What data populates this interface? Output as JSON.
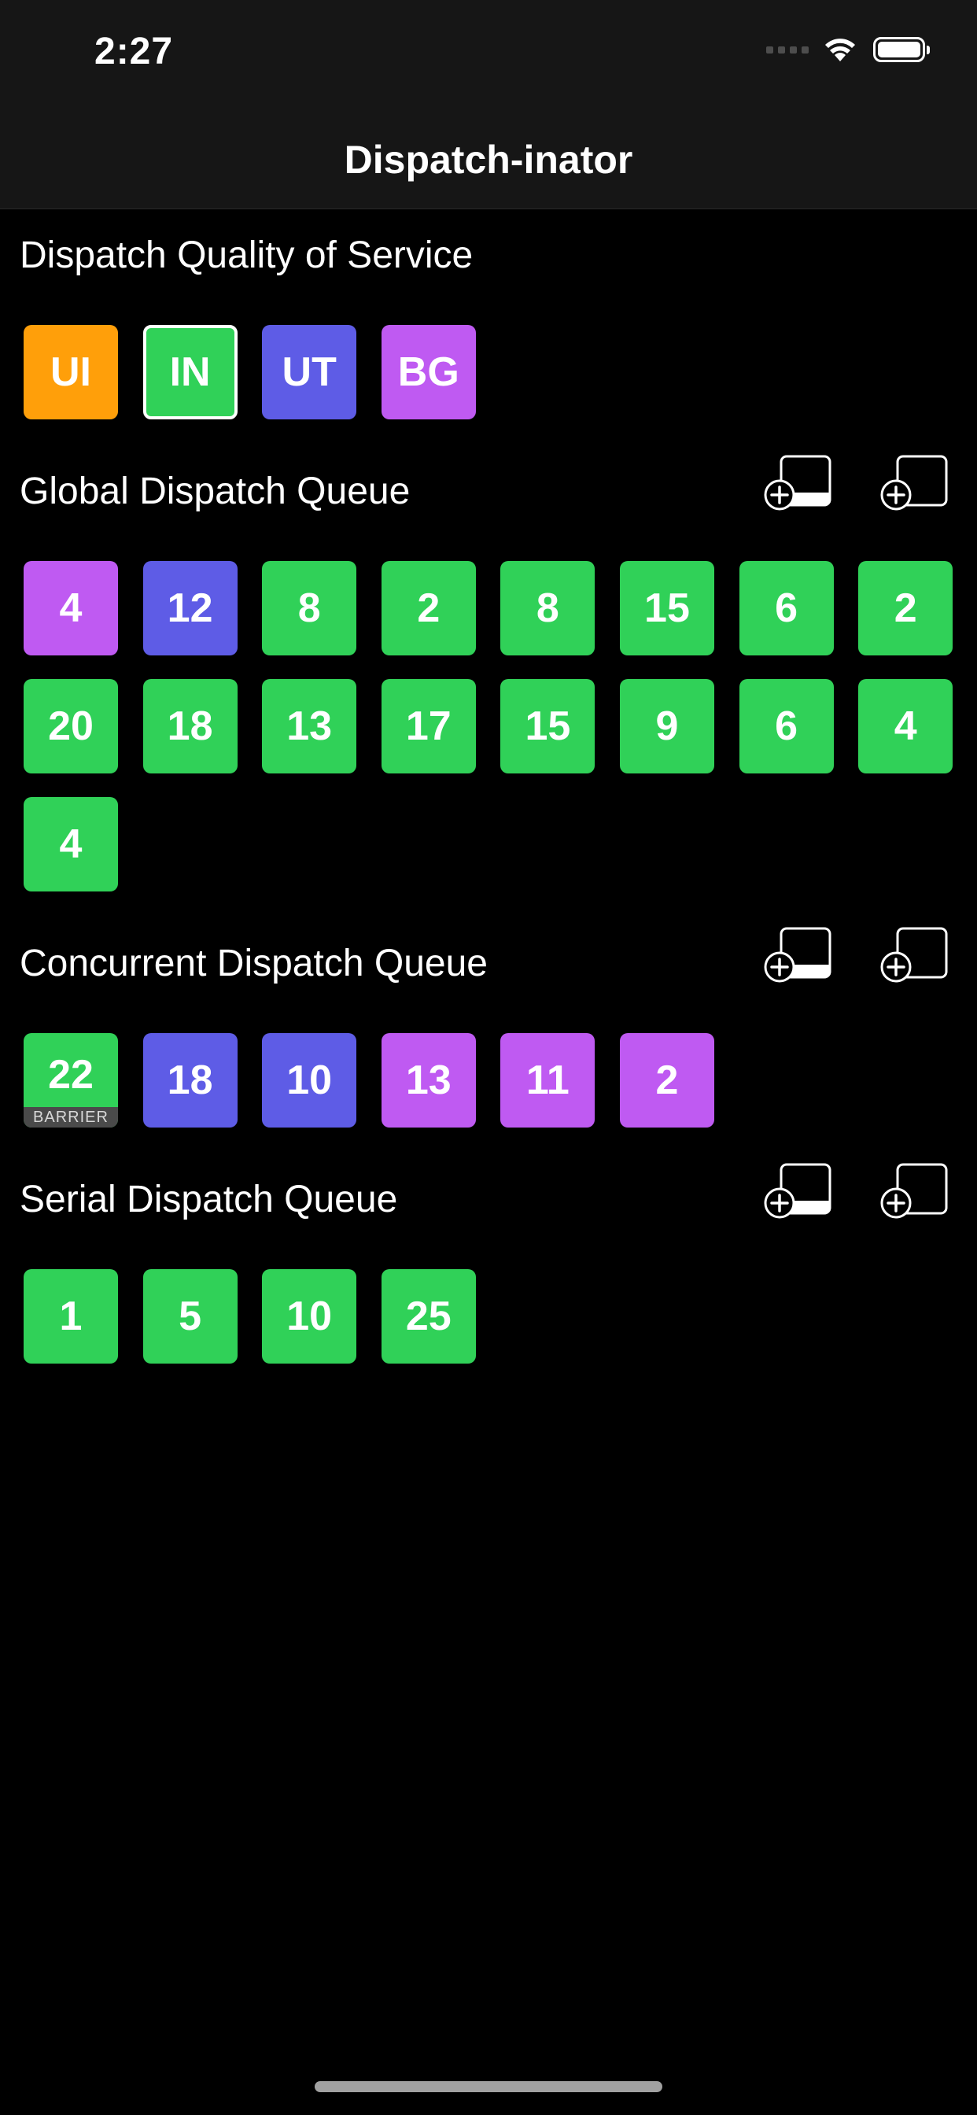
{
  "status_bar": {
    "time": "2:27"
  },
  "nav": {
    "title": "Dispatch-inator"
  },
  "colors": {
    "UI": "#ff9f0a",
    "IN": "#30d158",
    "UT": "#5e5ce6",
    "BG": "#bf5af2"
  },
  "qos": {
    "title": "Dispatch Quality of Service",
    "options": [
      {
        "label": "UI",
        "qos": "UI",
        "selected": false
      },
      {
        "label": "IN",
        "qos": "IN",
        "selected": true
      },
      {
        "label": "UT",
        "qos": "UT",
        "selected": false
      },
      {
        "label": "BG",
        "qos": "BG",
        "selected": false
      }
    ]
  },
  "global_queue": {
    "title": "Global Dispatch Queue",
    "actions": [
      "add-barrier-task-icon",
      "add-task-icon"
    ],
    "tasks": [
      {
        "value": "4",
        "qos": "BG"
      },
      {
        "value": "12",
        "qos": "UT"
      },
      {
        "value": "8",
        "qos": "IN"
      },
      {
        "value": "2",
        "qos": "IN"
      },
      {
        "value": "8",
        "qos": "IN"
      },
      {
        "value": "15",
        "qos": "IN"
      },
      {
        "value": "6",
        "qos": "IN"
      },
      {
        "value": "2",
        "qos": "IN"
      },
      {
        "value": "20",
        "qos": "IN"
      },
      {
        "value": "18",
        "qos": "IN"
      },
      {
        "value": "13",
        "qos": "IN"
      },
      {
        "value": "17",
        "qos": "IN"
      },
      {
        "value": "15",
        "qos": "IN"
      },
      {
        "value": "9",
        "qos": "IN"
      },
      {
        "value": "6",
        "qos": "IN"
      },
      {
        "value": "4",
        "qos": "IN"
      },
      {
        "value": "4",
        "qos": "IN"
      }
    ]
  },
  "concurrent_queue": {
    "title": "Concurrent Dispatch Queue",
    "actions": [
      "add-barrier-task-icon",
      "add-task-icon"
    ],
    "tasks": [
      {
        "value": "22",
        "qos": "IN",
        "barrier": "BARRIER"
      },
      {
        "value": "18",
        "qos": "UT"
      },
      {
        "value": "10",
        "qos": "UT"
      },
      {
        "value": "13",
        "qos": "BG"
      },
      {
        "value": "11",
        "qos": "BG"
      },
      {
        "value": "2",
        "qos": "BG"
      }
    ]
  },
  "serial_queue": {
    "title": "Serial Dispatch Queue",
    "actions": [
      "add-barrier-task-icon",
      "add-task-icon"
    ],
    "tasks": [
      {
        "value": "1",
        "qos": "IN"
      },
      {
        "value": "5",
        "qos": "IN"
      },
      {
        "value": "10",
        "qos": "IN"
      },
      {
        "value": "25",
        "qos": "IN"
      }
    ]
  }
}
